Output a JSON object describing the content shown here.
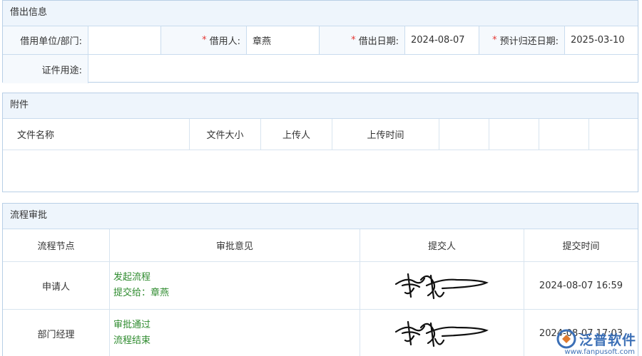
{
  "loan_info": {
    "title": "借出信息",
    "dept_label": "借用单位/部门:",
    "dept_value": "",
    "borrower_label": "借用人:",
    "borrower_value": "章燕",
    "date_label": "借出日期:",
    "date_value": "2024-08-07",
    "return_label": "预计归还日期:",
    "return_value": "2025-03-10",
    "purpose_label": "证件用途:",
    "purpose_value": "",
    "required_mark": "*"
  },
  "attachments": {
    "title": "附件",
    "columns": [
      "文件名称",
      "文件大小",
      "上传人",
      "上传时间"
    ]
  },
  "workflow": {
    "title": "流程审批",
    "columns": [
      "流程节点",
      "审批意见",
      "提交人",
      "提交时间"
    ],
    "rows": [
      {
        "node": "申请人",
        "opinion_1": "发起流程",
        "opinion_2": "提交给：章燕",
        "time": "2024-08-07 16:59"
      },
      {
        "node": "部门经理",
        "opinion_1": "审批通过",
        "opinion_2": "流程结束",
        "time": "2024-08-07 17:03"
      }
    ]
  },
  "watermark": {
    "brand": "泛普软件",
    "url": "www.fanpusoft.com"
  },
  "colors": {
    "accent": "#3b6fb6",
    "required": "#e53935",
    "approval_text": "#2e8b2e",
    "header_bg": "#eef5fc"
  }
}
